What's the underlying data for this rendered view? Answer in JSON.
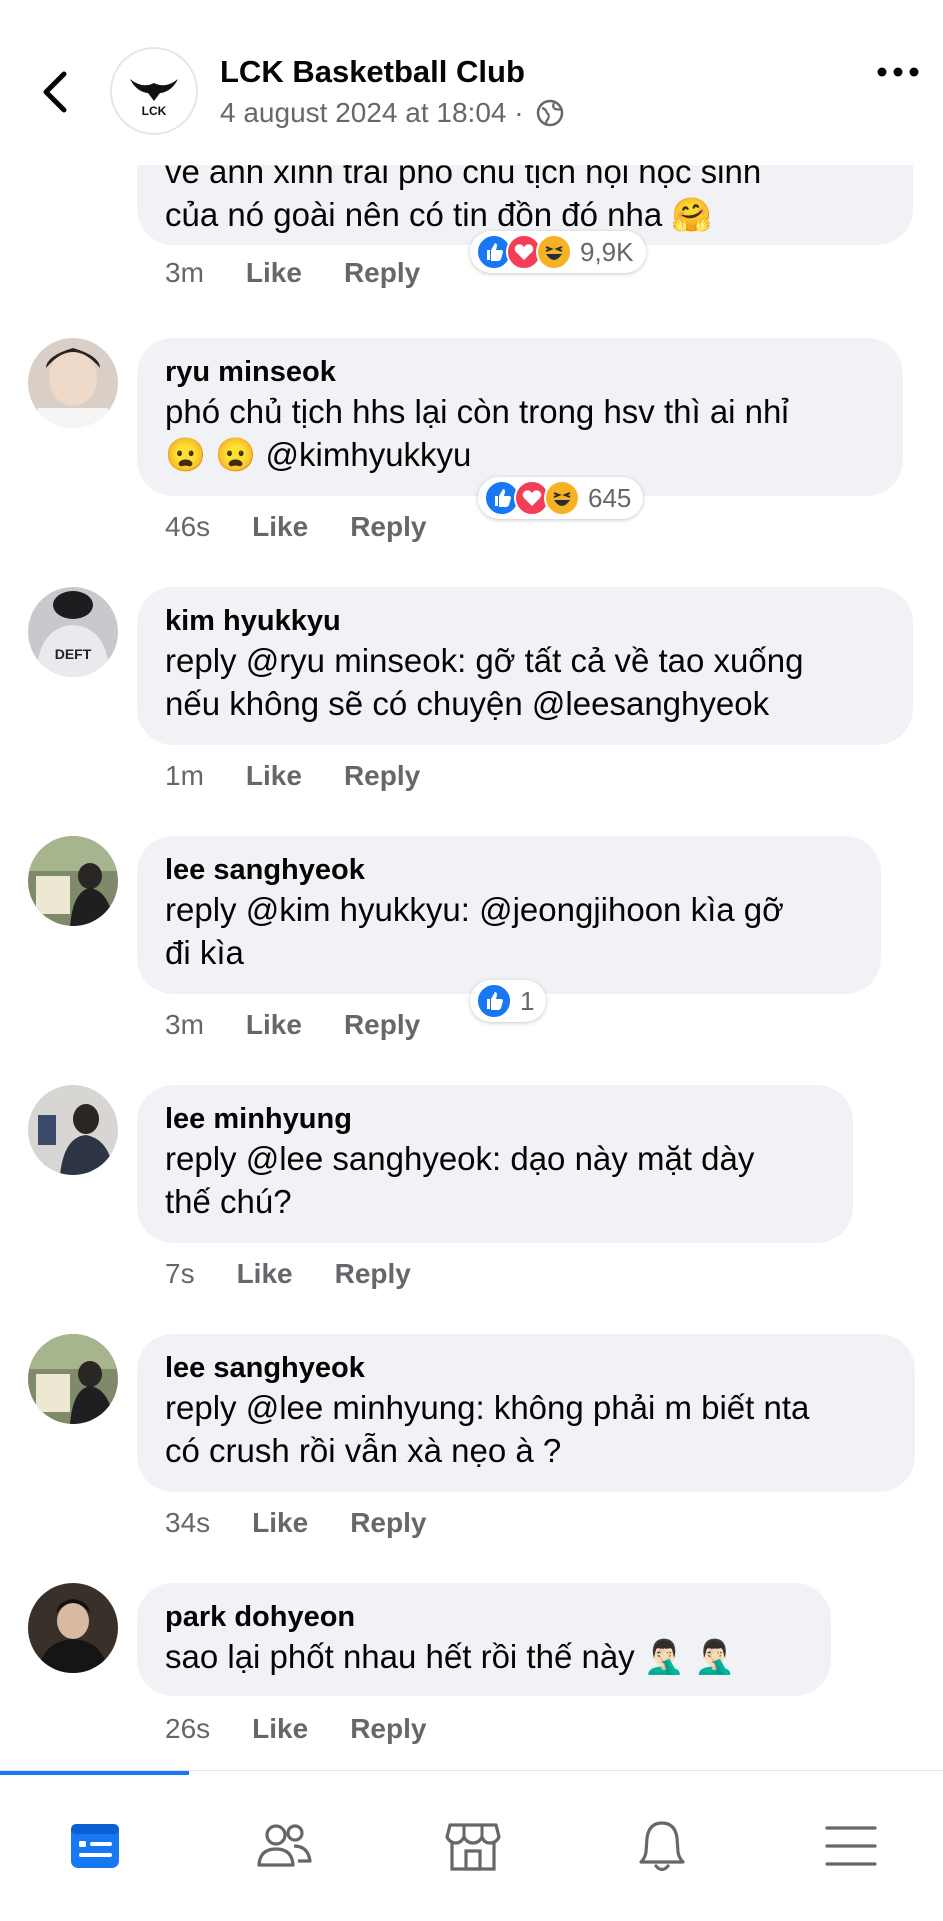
{
  "header": {
    "title": "LCK Basketball Club",
    "subtitle": "4 august 2024 at 18:04 ·",
    "logo_text": "LCK"
  },
  "colors": {
    "accent": "#1877f2",
    "like_blue": "#1877f2",
    "love_red": "#f33e58",
    "haha_yellow": "#f7b125",
    "bubble_bg": "#f0f2f5",
    "meta_gray": "#65676b"
  },
  "top_comment": {
    "text_line1": "về anh xinh trai phó chủ tịch hội học sinh",
    "text_line2": "của nó goài nên có tin đồn đó nha 🤗",
    "time": "3m",
    "like": "Like",
    "reply": "Reply",
    "reaction_count": "9,9K",
    "reactions": [
      "like",
      "love",
      "haha"
    ]
  },
  "comments": [
    {
      "author": "ryu minseok",
      "text": "phó chủ tịch hhs lại còn trong hsv thì ai nhỉ\n😦 😦  @kimhyukkyu",
      "time": "46s",
      "like": "Like",
      "reply": "Reply",
      "reaction_count": "645",
      "reactions": [
        "like",
        "love",
        "haha"
      ]
    },
    {
      "author": "kim hyukkyu",
      "text": "reply @ryu minseok: gỡ tất cả về tao xuống\nnếu không sẽ có chuyện @leesanghyeok",
      "time": "1m",
      "like": "Like",
      "reply": "Reply"
    },
    {
      "author": "lee sanghyeok",
      "text": "reply @kim hyukkyu: @jeongjihoon kìa gỡ\nđi kìa",
      "time": "3m",
      "like": "Like",
      "reply": "Reply",
      "reaction_count": "1",
      "reactions": [
        "like"
      ]
    },
    {
      "author": "lee minhyung",
      "text": "reply @lee sanghyeok: dạo này mặt dày\nthế chú?",
      "time": "7s",
      "like": "Like",
      "reply": "Reply"
    },
    {
      "author": "lee sanghyeok",
      "text": "reply @lee minhyung: không phải m biết nta\ncó crush rồi vẫn xà nẹo à ?",
      "time": "34s",
      "like": "Like",
      "reply": "Reply"
    },
    {
      "author": "park dohyeon",
      "text": "sao lại phốt nhau hết rồi thế này 🤦🏻‍♂️ 🤦🏻‍♂️",
      "time": "26s",
      "like": "Like",
      "reply": "Reply"
    }
  ],
  "nav": {
    "tabs": [
      {
        "icon": "feed-icon",
        "active": true
      },
      {
        "icon": "friends-icon",
        "active": false
      },
      {
        "icon": "marketplace-icon",
        "active": false
      },
      {
        "icon": "bell-icon",
        "active": false
      },
      {
        "icon": "menu-icon",
        "active": false
      }
    ]
  }
}
